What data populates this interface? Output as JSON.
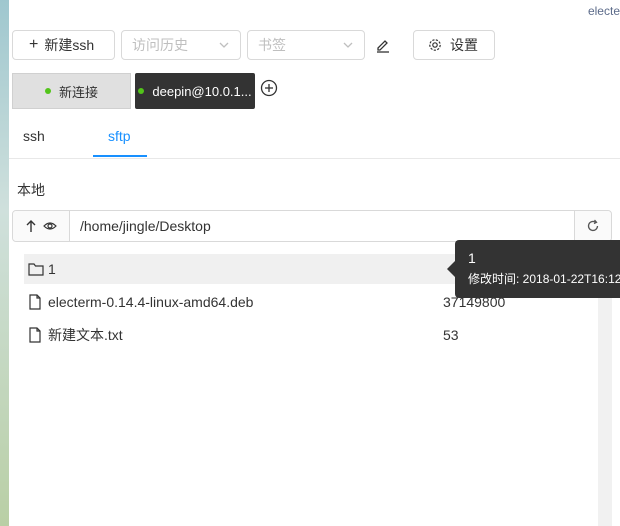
{
  "app": {
    "title": "electe"
  },
  "toolbar": {
    "new_ssh_label": "新建ssh",
    "history_placeholder": "访问历史",
    "bookmarks_placeholder": "书签",
    "settings_label": "设置"
  },
  "tabs": [
    {
      "label": "新连接",
      "status_color": "#52c41a",
      "active": false
    },
    {
      "label": "deepin@10.0.1...",
      "status_color": "#52c41a",
      "active": true
    }
  ],
  "subtabs": [
    {
      "label": "ssh",
      "active": false
    },
    {
      "label": "sftp",
      "active": true
    }
  ],
  "local": {
    "title": "本地",
    "path": "/home/jingle/Desktop"
  },
  "files": [
    {
      "name": "1",
      "size": "",
      "type": "folder",
      "selected": true
    },
    {
      "name": "electerm-0.14.4-linux-amd64.deb",
      "size": "37149800",
      "type": "file",
      "selected": false
    },
    {
      "name": "新建文本.txt",
      "size": "53",
      "type": "file",
      "selected": false
    }
  ],
  "tooltip": {
    "name": "1",
    "modified": "修改时间: 2018-01-22T16:12"
  },
  "colors": {
    "accent": "#1890ff",
    "status_online": "#52c41a",
    "tab_active_bg": "#333333"
  },
  "icons": {
    "add": "plus-icon",
    "edit": "edit-icon",
    "settings": "gear-icon",
    "new_tab": "plus-circle-icon",
    "up": "arrow-up-icon",
    "view": "eye-icon",
    "refresh": "reload-icon",
    "folder": "folder-icon",
    "file": "file-icon"
  }
}
